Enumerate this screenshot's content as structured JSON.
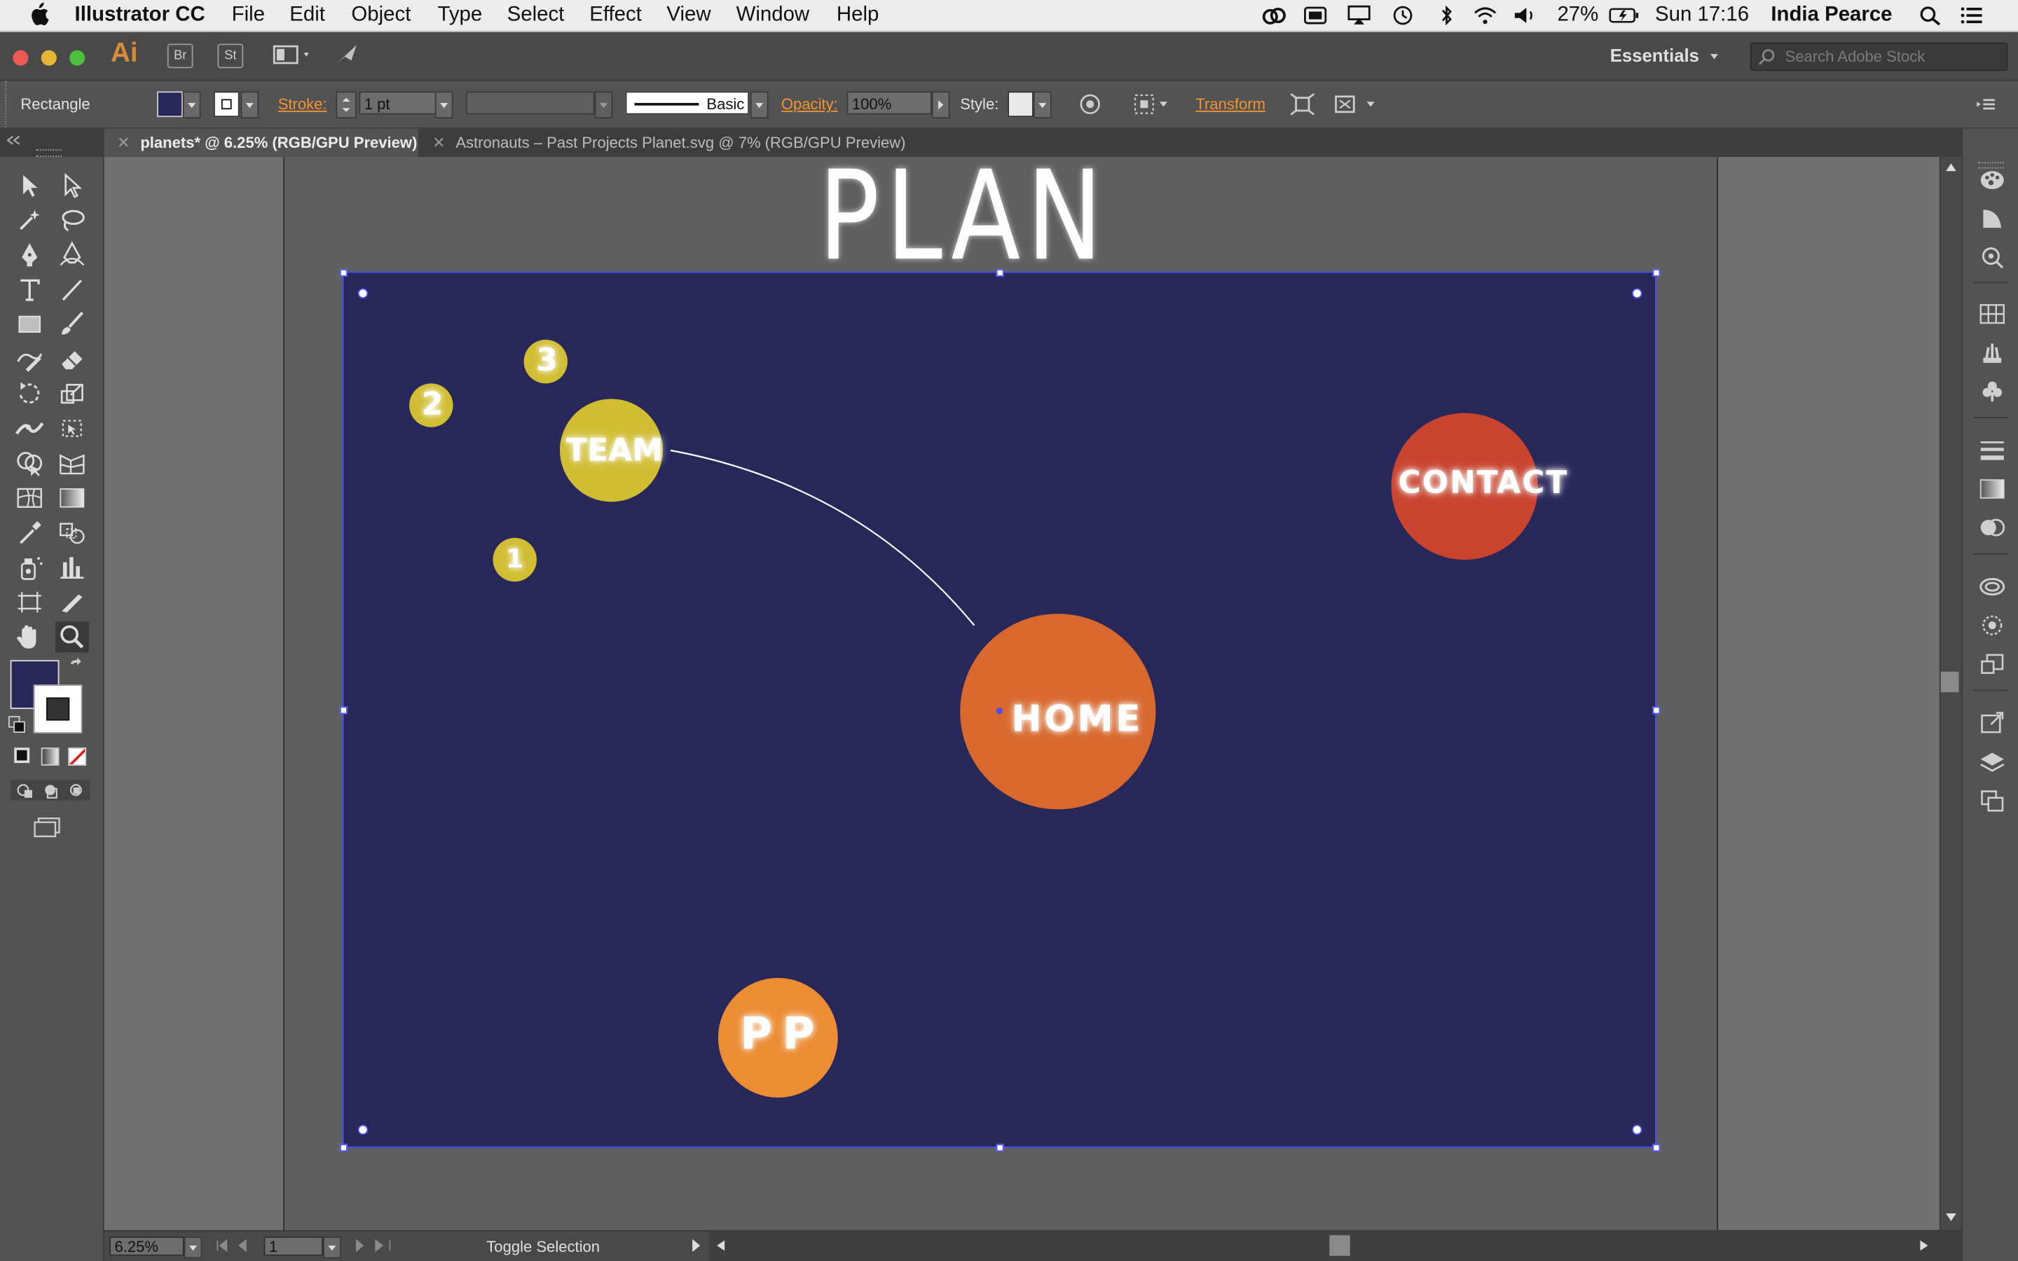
{
  "menubar": {
    "app_name": "Illustrator CC",
    "menus": [
      "File",
      "Edit",
      "Object",
      "Type",
      "Select",
      "Effect",
      "View",
      "Window",
      "Help"
    ],
    "battery": "27%",
    "clock": "Sun 17:16",
    "user": "India Pearce"
  },
  "appbar": {
    "logo": "Ai",
    "bridge": "Br",
    "stock": "St",
    "workspace": "Essentials",
    "search_placeholder": "Search Adobe Stock"
  },
  "control": {
    "tool_name": "Rectangle",
    "stroke_label": "Stroke:",
    "stroke_value": "1 pt",
    "brush_label": "Basic",
    "opacity_label": "Opacity:",
    "opacity_value": "100%",
    "style_label": "Style:",
    "transform_label": "Transform",
    "fill_color": "#28275a"
  },
  "tabs": [
    {
      "title": "planets* @ 6.25% (RGB/GPU Preview)",
      "active": true
    },
    {
      "title": "Astronauts – Past Projects Planet.svg @ 7% (RGB/GPU Preview)",
      "active": false
    }
  ],
  "artwork": {
    "title": "PLAN",
    "background": "#28275a",
    "planets": [
      {
        "label": "TEAM",
        "color": "#d1bd32"
      },
      {
        "label": "2",
        "color": "#d1bd32"
      },
      {
        "label": "3",
        "color": "#d1bd32"
      },
      {
        "label": "1",
        "color": "#d1bd32"
      },
      {
        "label": "CONTACT",
        "color": "#c9442f"
      },
      {
        "label": "HOME",
        "color": "#d8682e"
      },
      {
        "label": "PP",
        "color": "#ec8c33"
      }
    ]
  },
  "status": {
    "zoom": "6.25%",
    "artboard": "1",
    "message": "Toggle Selection"
  }
}
